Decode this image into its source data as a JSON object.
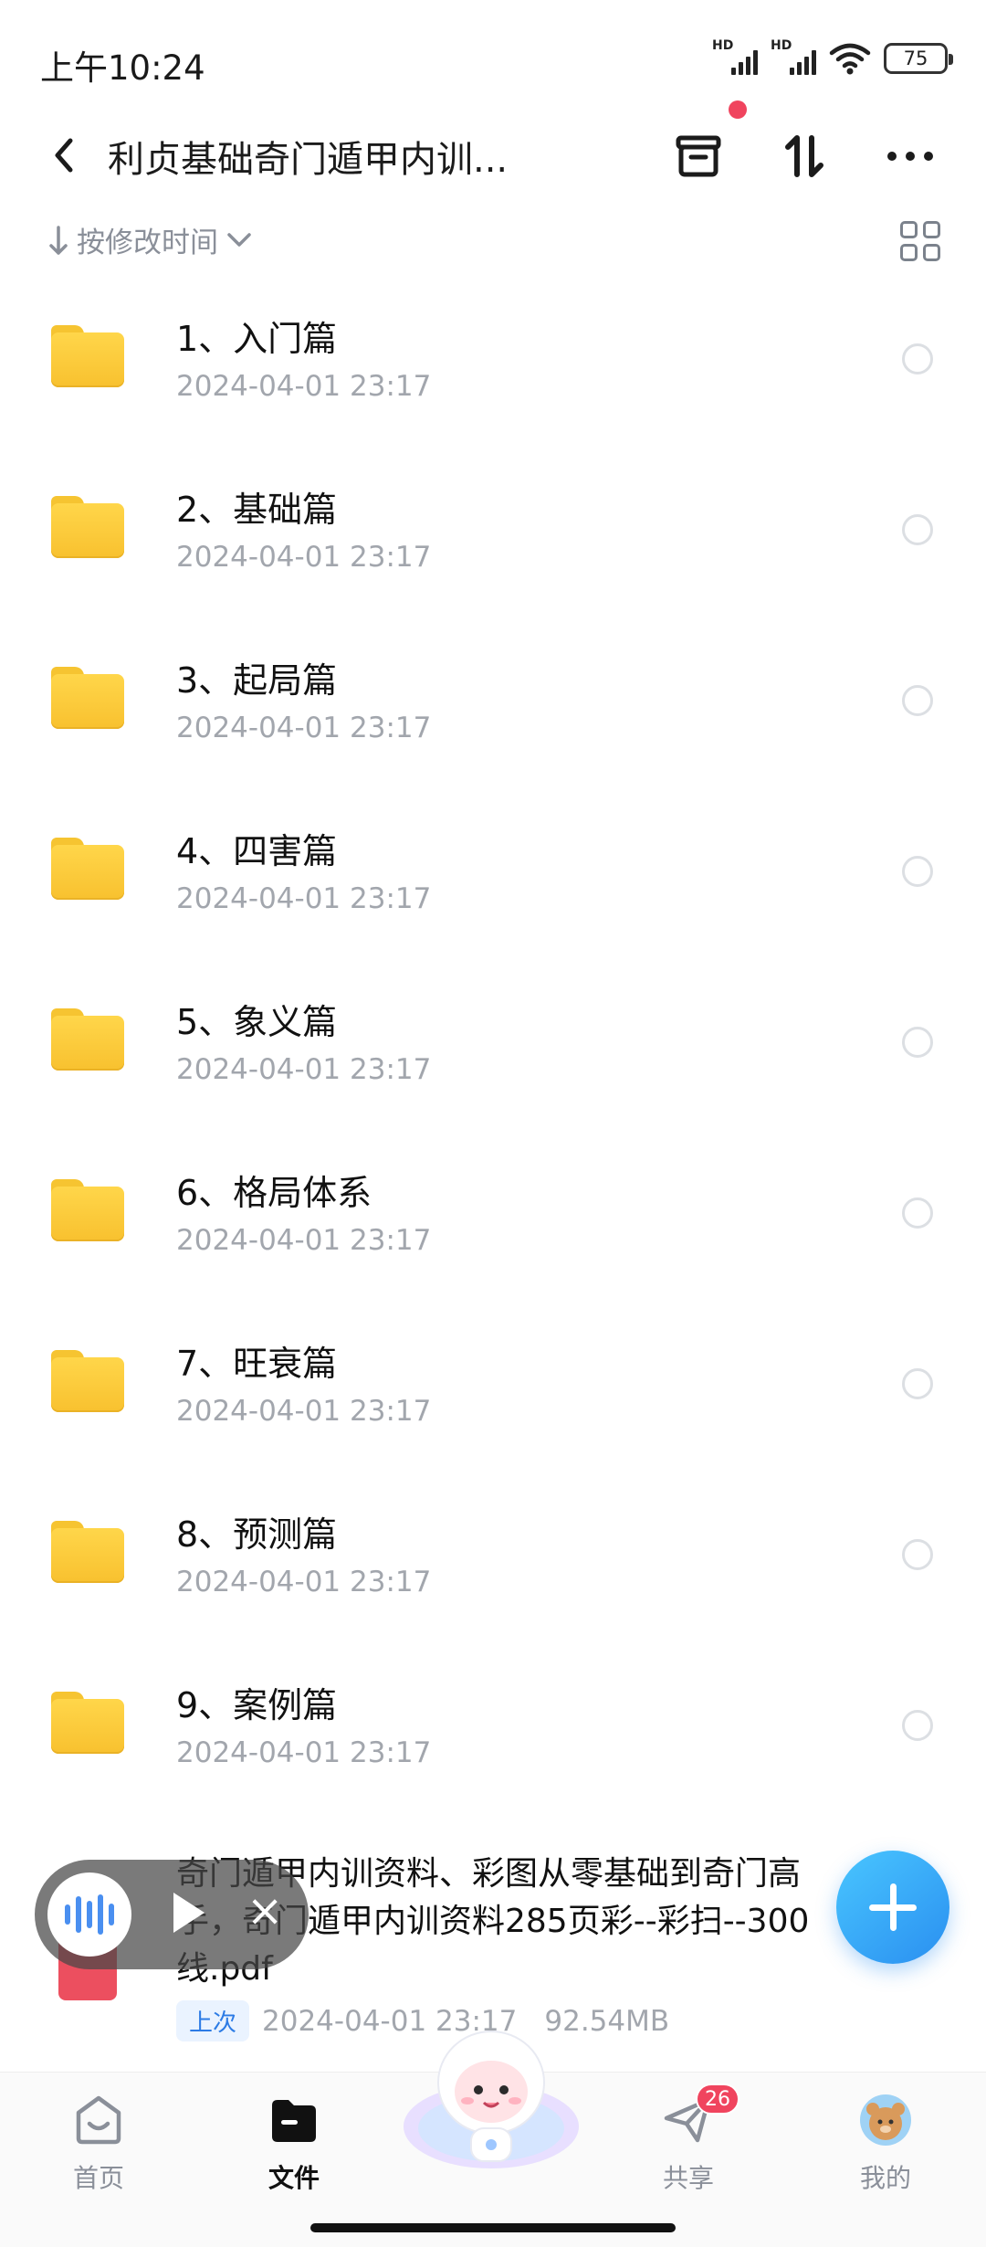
{
  "status_bar": {
    "time": "上午10:24",
    "sim1_label": "HD",
    "sim2_label": "HD",
    "battery": "75"
  },
  "header": {
    "title": "利贞基础奇门遁甲内训...",
    "icons": [
      "back-icon",
      "recycle-bin-icon",
      "sort-icon",
      "more-icon"
    ],
    "notification_dot_color": "#f0445e"
  },
  "sort_bar": {
    "label": "按修改时间",
    "view_toggle_icon": "grid-view-icon"
  },
  "folders": [
    {
      "name": "1、入门篇",
      "date": "2024-04-01  23:17"
    },
    {
      "name": "2、基础篇",
      "date": "2024-04-01  23:17"
    },
    {
      "name": "3、起局篇",
      "date": "2024-04-01  23:17"
    },
    {
      "name": "4、四害篇",
      "date": "2024-04-01  23:17"
    },
    {
      "name": "5、象义篇",
      "date": "2024-04-01  23:17"
    },
    {
      "name": "6、格局体系",
      "date": "2024-04-01  23:17"
    },
    {
      "name": "7、旺衰篇",
      "date": "2024-04-01  23:17"
    },
    {
      "name": "8、预测篇",
      "date": "2024-04-01  23:17"
    },
    {
      "name": "9、案例篇",
      "date": "2024-04-01  23:17"
    }
  ],
  "pdf_item": {
    "name": "奇门遁甲内训资料、彩图从零基础到奇门高手，奇门遁甲内训资料285页彩--彩扫--300线.pdf",
    "tag": "上次",
    "date": "2024-04-01  23:17",
    "size": "92.54MB"
  },
  "floating_player": {
    "icons": [
      "audio-wave-icon",
      "play-icon",
      "close-icon"
    ],
    "close_glyph": "×"
  },
  "fab": {
    "icon": "plus-icon",
    "color": "#2a8ff0"
  },
  "bottom_nav": {
    "items": [
      {
        "label": "首页",
        "icon": "home-icon",
        "active": false
      },
      {
        "label": "文件",
        "icon": "folder-icon",
        "active": true
      },
      {
        "label": "共享",
        "icon": "send-icon",
        "active": false,
        "badge": "26"
      },
      {
        "label": "我的",
        "icon": "avatar-icon",
        "active": false
      }
    ]
  },
  "colors": {
    "folder": "#f8c12f",
    "accent": "#2a8ff0",
    "secondary_text": "#a2a6ad"
  }
}
